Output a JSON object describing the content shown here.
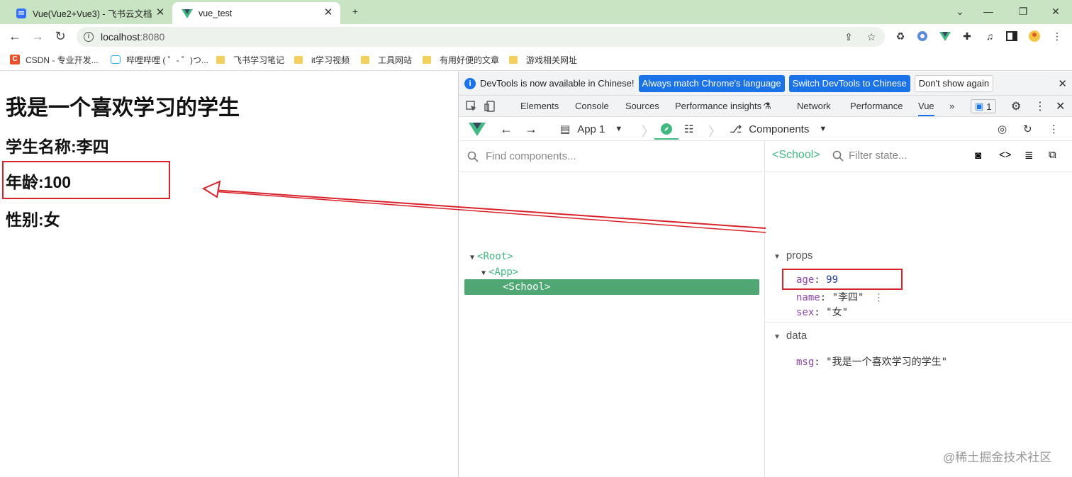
{
  "browser": {
    "tabs": [
      {
        "title": "Vue(Vue2+Vue3) - 飞书云文档",
        "active": false,
        "icon": "doc-icon"
      },
      {
        "title": "vue_test",
        "active": true,
        "icon": "vue-logo-icon"
      }
    ],
    "new_tab": "+",
    "url_host": "localhost",
    "url_port": ":8080",
    "bookmarks": [
      "CSDN - 专业开发...",
      "哔哩哔哩 ( ゜- ゜)つ...",
      "飞书学习笔记",
      "it学习视频",
      "工具网站",
      "有用好便的文章",
      "游戏相关网址"
    ]
  },
  "page": {
    "heading": "我是一个喜欢学习的学生",
    "name_line": "学生名称:李四",
    "age_line": "年龄:100",
    "sex_line": "性别:女"
  },
  "devtools": {
    "infobar": {
      "message": "DevTools is now available in Chinese!",
      "btn_match": "Always match Chrome's language",
      "btn_switch": "Switch DevTools to Chinese",
      "btn_dismiss": "Don't show again"
    },
    "tabs": [
      "Elements",
      "Console",
      "Sources",
      "Performance insights",
      "Network",
      "Performance",
      "Vue"
    ],
    "active_tab": "Vue",
    "more": "»",
    "issues_count": "1",
    "vue": {
      "app_selector": "App 1",
      "components_label": "Components",
      "find_placeholder": "Find components...",
      "selected_component": "<School>",
      "filter_placeholder": "Filter state...",
      "tree": [
        {
          "label": "<Root>"
        },
        {
          "label": "<App>"
        },
        {
          "label": "<School>"
        }
      ],
      "props_label": "props",
      "props": [
        {
          "key": "age",
          "value": "99"
        },
        {
          "key": "name",
          "value": "\"李四\""
        },
        {
          "key": "sex",
          "value": "\"女\""
        }
      ],
      "data_label": "data",
      "data": [
        {
          "key": "msg",
          "value": "\"我是一个喜欢学习的学生\""
        }
      ]
    }
  },
  "watermark": "@稀土掘金技术社区",
  "colors": {
    "vue_green": "#42b883",
    "annotation_red": "#d9222a",
    "chrome_blue": "#1a73e8",
    "tabstrip": "#c9e4c2"
  }
}
